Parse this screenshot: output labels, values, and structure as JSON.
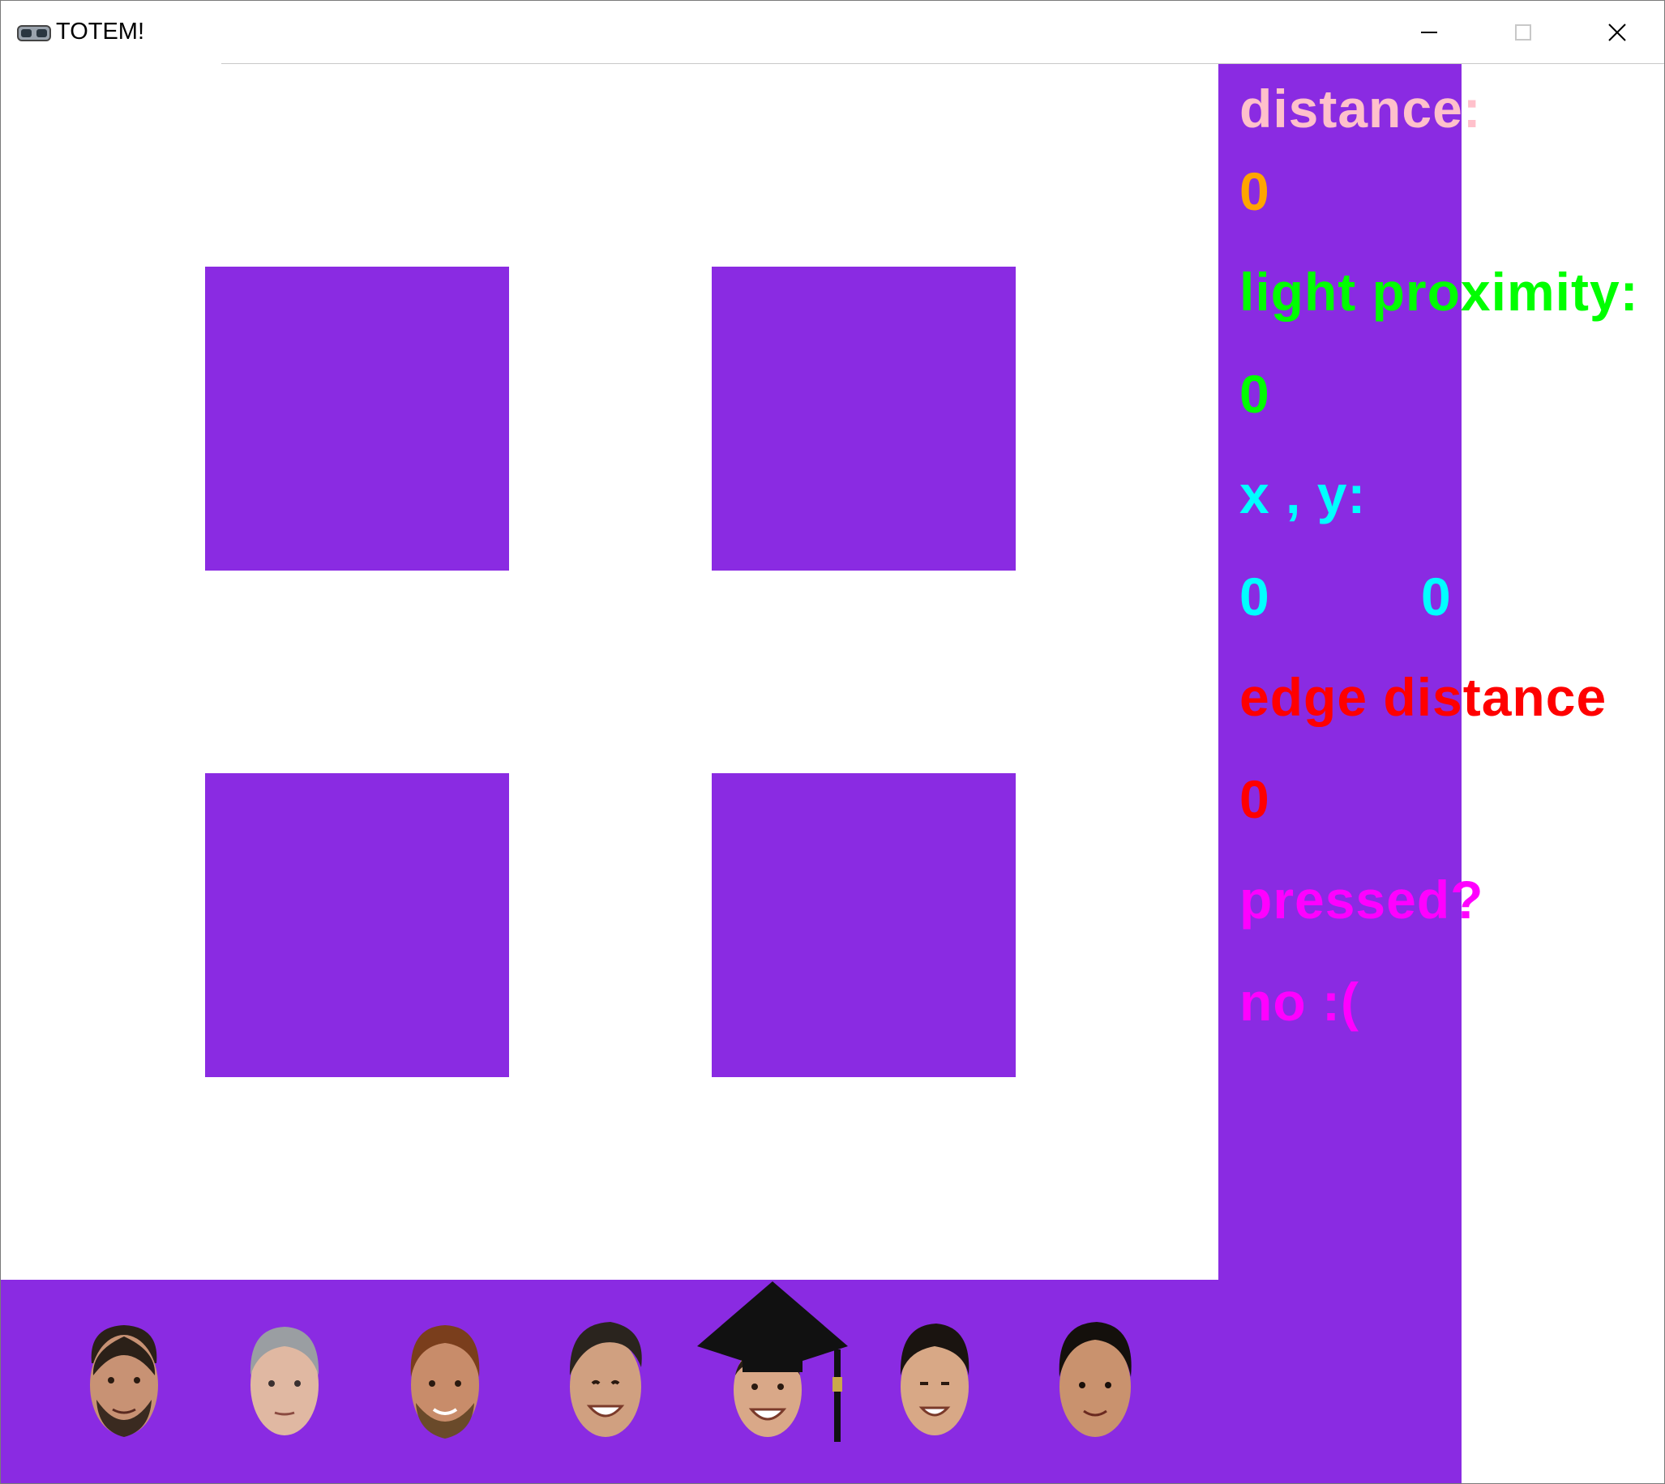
{
  "window": {
    "title": "TOTEM!",
    "app_icon": "vr-goggles-icon",
    "controls": {
      "minimize": "minimize-icon",
      "maximize": "maximize-icon",
      "close": "close-icon"
    }
  },
  "board": {
    "tile_color": "#8a2be2",
    "tiles": [
      "top-left",
      "top-right",
      "bottom-left",
      "bottom-right"
    ]
  },
  "status": {
    "distance_label": "distance:",
    "distance_value": "0",
    "light_label": "light proximity:",
    "light_value": "0",
    "xy_label": "x , y:",
    "x_value": "0",
    "y_value": "0",
    "edge_label": "edge distance",
    "edge_value": "0",
    "pressed_label": "pressed?",
    "pressed_value": "no :("
  },
  "colors": {
    "panel": "#8a2be2",
    "distance_label": "#ffc0cb",
    "distance_value": "#ffa500",
    "light": "#00ff00",
    "xy": "#00ffff",
    "edge": "#ff0000",
    "pressed": "#ff00ff"
  },
  "team": {
    "portraits": [
      "face-1",
      "face-2",
      "face-3",
      "face-4",
      "face-5",
      "face-6",
      "face-7"
    ],
    "selected_decoration": "graduation-cap-icon"
  }
}
